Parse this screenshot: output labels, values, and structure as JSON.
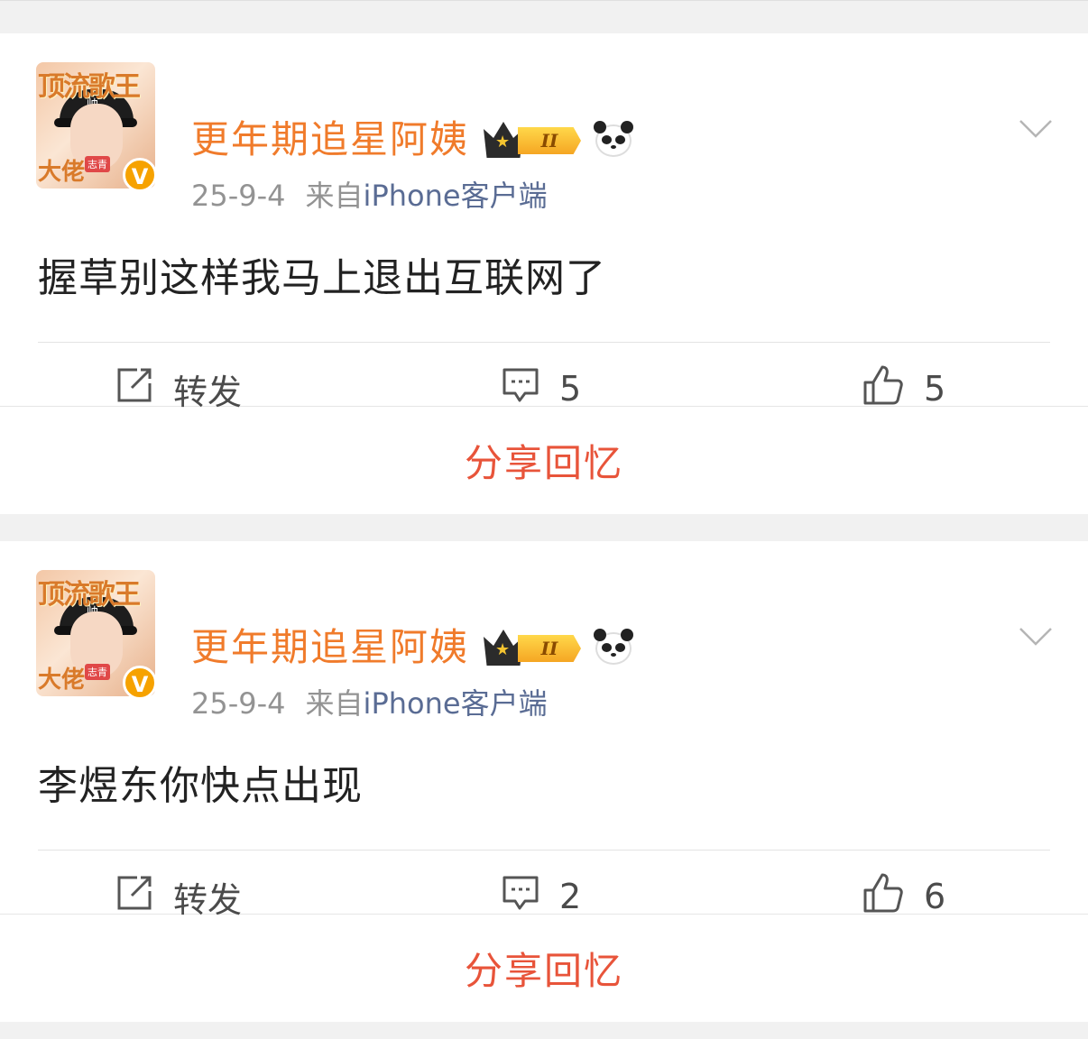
{
  "posts": [
    {
      "username": "更年期追星阿姨",
      "level": "II",
      "date": "25-9-4",
      "source_prefix": "来自",
      "source": "iPhone客户端",
      "content": "握草别这样我马上退出互联网了",
      "actions": {
        "repost_label": "转发",
        "comment_count": "5",
        "like_count": "5"
      },
      "share_label": "分享回忆",
      "avatar": {
        "frame_text_top": "顶流歌王",
        "frame_text_bottom": "大佬",
        "name_tag": "志青",
        "cap_logo": "帅",
        "verified": "V"
      }
    },
    {
      "username": "更年期追星阿姨",
      "level": "II",
      "date": "25-9-4",
      "source_prefix": "来自",
      "source": "iPhone客户端",
      "content": "李煜东你快点出现",
      "actions": {
        "repost_label": "转发",
        "comment_count": "2",
        "like_count": "6"
      },
      "share_label": "分享回忆",
      "avatar": {
        "frame_text_top": "顶流歌王",
        "frame_text_bottom": "大佬",
        "name_tag": "志青",
        "cap_logo": "帅",
        "verified": "V"
      }
    }
  ],
  "colors": {
    "username": "#f07b2b",
    "source": "#5a6c94",
    "share": "#e8543a",
    "verified": "#f6a200"
  }
}
